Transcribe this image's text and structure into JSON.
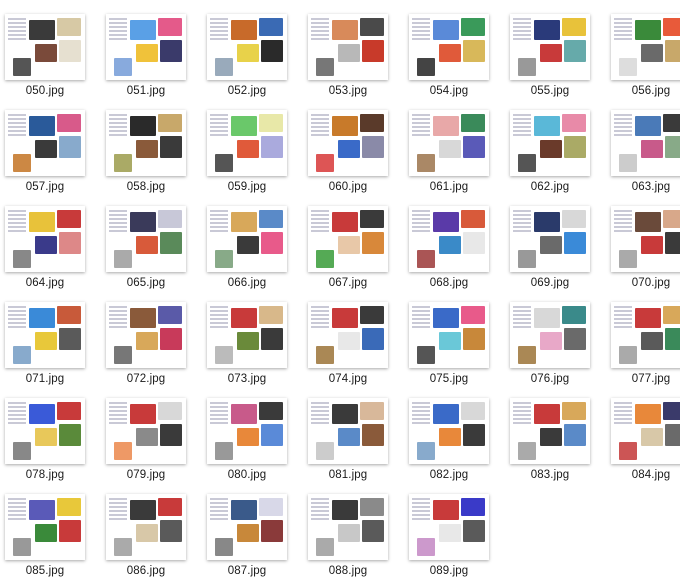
{
  "files": [
    {
      "name": "050.jpg",
      "c": [
        "#3a3a3a",
        "#d7c9a5",
        "#7a4a3a",
        "#e6e0d0",
        "#555"
      ]
    },
    {
      "name": "051.jpg",
      "c": [
        "#5aa0e6",
        "#e45a8a",
        "#f0c23a",
        "#3a3a6a",
        "#8ad"
      ]
    },
    {
      "name": "052.jpg",
      "c": [
        "#c86a2a",
        "#3a6ab4",
        "#e8d24a",
        "#2a2a2a",
        "#9ab"
      ]
    },
    {
      "name": "053.jpg",
      "c": [
        "#d88a5a",
        "#4a4a4a",
        "#b8b8b8",
        "#c83a2a",
        "#777"
      ]
    },
    {
      "name": "054.jpg",
      "c": [
        "#5a8ad8",
        "#3a9a5a",
        "#e05a3a",
        "#d8b85a",
        "#444"
      ]
    },
    {
      "name": "055.jpg",
      "c": [
        "#2a3a7a",
        "#e8c23a",
        "#c83a3a",
        "#6aa",
        "#999"
      ]
    },
    {
      "name": "056.jpg",
      "c": [
        "#3a8a3a",
        "#e85a3a",
        "#6a6a6a",
        "#c8a86a",
        "#ddd"
      ]
    },
    {
      "name": "057.jpg",
      "c": [
        "#2a5a9a",
        "#d85a8a",
        "#3a3a3a",
        "#8ac",
        "#c84"
      ]
    },
    {
      "name": "058.jpg",
      "c": [
        "#2a2a2a",
        "#c8a86a",
        "#8a5a3a",
        "#3a3a3a",
        "#aa6"
      ]
    },
    {
      "name": "059.jpg",
      "c": [
        "#6ac86a",
        "#e8e8a8",
        "#e05a3a",
        "#aad",
        "#555"
      ]
    },
    {
      "name": "060.jpg",
      "c": [
        "#c87a2a",
        "#5a3a2a",
        "#3a6ac8",
        "#8a8aa8",
        "#d55"
      ]
    },
    {
      "name": "061.jpg",
      "c": [
        "#e8a8a8",
        "#3a8a5a",
        "#d8d8d8",
        "#5a5ab8",
        "#a86"
      ]
    },
    {
      "name": "062.jpg",
      "c": [
        "#5ab8d8",
        "#e88aa8",
        "#6a3a2a",
        "#aa6",
        "#555"
      ]
    },
    {
      "name": "063.jpg",
      "c": [
        "#4a7ab8",
        "#3a3a3a",
        "#c85a8a",
        "#8a8",
        "#ccc"
      ]
    },
    {
      "name": "064.jpg",
      "c": [
        "#e8c23a",
        "#c83a3a",
        "#3a3a8a",
        "#d88",
        "#888"
      ]
    },
    {
      "name": "065.jpg",
      "c": [
        "#3a3a5a",
        "#c8c8d8",
        "#d85a3a",
        "#5a8a5a",
        "#aaa"
      ]
    },
    {
      "name": "066.jpg",
      "c": [
        "#d8a85a",
        "#5a8ac8",
        "#3a3a3a",
        "#e85a8a",
        "#8a8"
      ]
    },
    {
      "name": "067.jpg",
      "c": [
        "#c83a3a",
        "#3a3a3a",
        "#e8c8a8",
        "#d8883a",
        "#5a5"
      ]
    },
    {
      "name": "068.jpg",
      "c": [
        "#5a3aa8",
        "#d85a3a",
        "#3a8ac8",
        "#e8e8e8",
        "#a55"
      ]
    },
    {
      "name": "069.jpg",
      "c": [
        "#2a3a6a",
        "#d8d8d8",
        "#6a6a6a",
        "#3a8ad8",
        "#999"
      ]
    },
    {
      "name": "070.jpg",
      "c": [
        "#6a4a3a",
        "#d8a88a",
        "#c83a3a",
        "#3a3a3a",
        "#aaa"
      ]
    },
    {
      "name": "071.jpg",
      "c": [
        "#3a8ad8",
        "#c85a3a",
        "#e8c83a",
        "#5a5a5a",
        "#8ac"
      ]
    },
    {
      "name": "072.jpg",
      "c": [
        "#8a5a3a",
        "#5a5aa8",
        "#d8a85a",
        "#c83a5a",
        "#777"
      ]
    },
    {
      "name": "073.jpg",
      "c": [
        "#c83a3a",
        "#d8b88a",
        "#6a8a3a",
        "#3a3a3a",
        "#bbb"
      ]
    },
    {
      "name": "074.jpg",
      "c": [
        "#c83a3a",
        "#3a3a3a",
        "#e8e8e8",
        "#3a6ab8",
        "#a85"
      ]
    },
    {
      "name": "075.jpg",
      "c": [
        "#3a6ac8",
        "#e85a8a",
        "#6ac8d8",
        "#c8883a",
        "#555"
      ]
    },
    {
      "name": "076.jpg",
      "c": [
        "#d8d8d8",
        "#3a8a8a",
        "#e8a8c8",
        "#6a6a6a",
        "#a85"
      ]
    },
    {
      "name": "077.jpg",
      "c": [
        "#c83a3a",
        "#d8a85a",
        "#5a5a5a",
        "#3a8a5a",
        "#aaa"
      ]
    },
    {
      "name": "078.jpg",
      "c": [
        "#3a5ad8",
        "#c83a3a",
        "#e8c85a",
        "#5a8a3a",
        "#888"
      ]
    },
    {
      "name": "079.jpg",
      "c": [
        "#c83a3a",
        "#d8d8d8",
        "#8a8a8a",
        "#3a3a3a",
        "#e96"
      ]
    },
    {
      "name": "080.jpg",
      "c": [
        "#c85a8a",
        "#3a3a3a",
        "#e8883a",
        "#5a8ad8",
        "#999"
      ]
    },
    {
      "name": "081.jpg",
      "c": [
        "#3a3a3a",
        "#d8b89a",
        "#5a8ac8",
        "#8a5a3a",
        "#ccc"
      ]
    },
    {
      "name": "082.jpg",
      "c": [
        "#3a6ac8",
        "#d8d8d8",
        "#e8883a",
        "#3a3a3a",
        "#8ac"
      ]
    },
    {
      "name": "083.jpg",
      "c": [
        "#c83a3a",
        "#d8a85a",
        "#3a3a3a",
        "#5a8ac8",
        "#aaa"
      ]
    },
    {
      "name": "084.jpg",
      "c": [
        "#e8883a",
        "#3a3a6a",
        "#d8c8a8",
        "#6a6a6a",
        "#c55"
      ]
    },
    {
      "name": "085.jpg",
      "c": [
        "#5a5ab8",
        "#e8c83a",
        "#3a8a3a",
        "#c83a3a",
        "#999"
      ]
    },
    {
      "name": "086.jpg",
      "c": [
        "#3a3a3a",
        "#c83a3a",
        "#d8c8a8",
        "#5a5a5a",
        "#aaa"
      ]
    },
    {
      "name": "087.jpg",
      "c": [
        "#3a5a8a",
        "#d8d8e8",
        "#c8883a",
        "#8a3a3a",
        "#888"
      ]
    },
    {
      "name": "088.jpg",
      "c": [
        "#3a3a3a",
        "#8a8a8a",
        "#c8c8c8",
        "#5a5a5a",
        "#aaa"
      ]
    },
    {
      "name": "089.jpg",
      "c": [
        "#c83a3a",
        "#3a3ac8",
        "#e8e8e8",
        "#5a5a5a",
        "#c9c"
      ]
    }
  ]
}
